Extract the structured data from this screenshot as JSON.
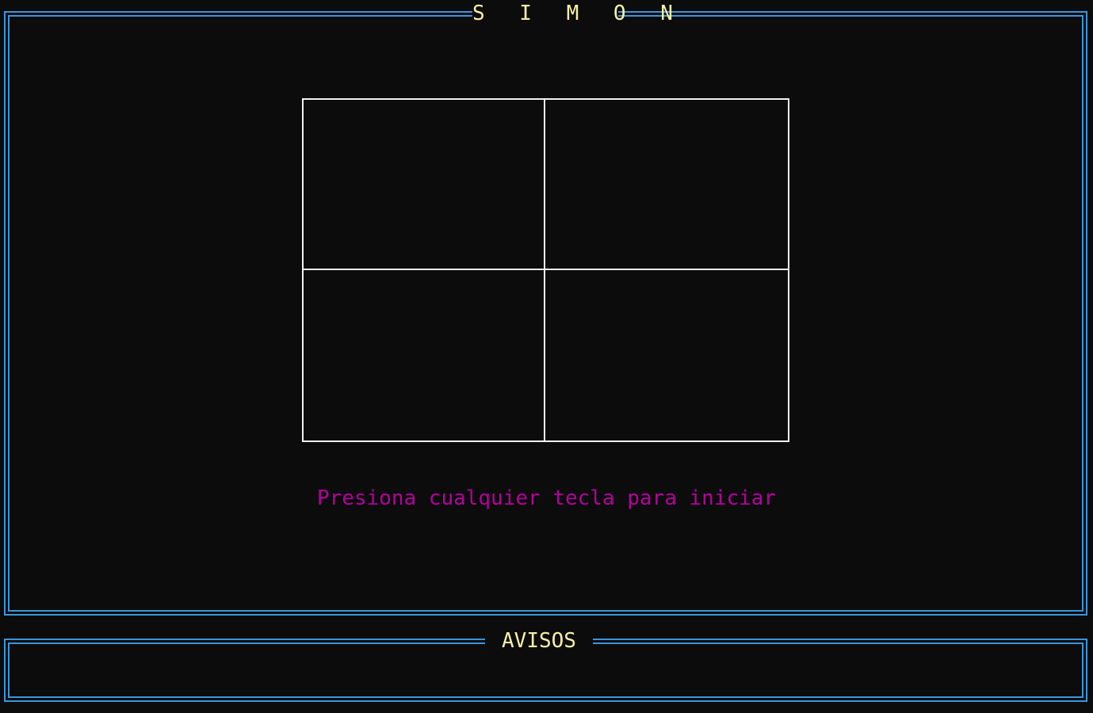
{
  "game": {
    "title": "S I M O N",
    "start_prompt": "Presiona cualquier tecla para iniciar"
  },
  "board": {
    "pads": [
      "top-left",
      "top-right",
      "bottom-left",
      "bottom-right"
    ]
  },
  "notices": {
    "title": "AVISOS",
    "message": ""
  },
  "colors": {
    "background": "#0c0c0c",
    "frame_border": "#3a96dd",
    "title_text": "#f9f1a5",
    "board_lines": "#f2f2f2",
    "prompt_text": "#b4009e"
  }
}
